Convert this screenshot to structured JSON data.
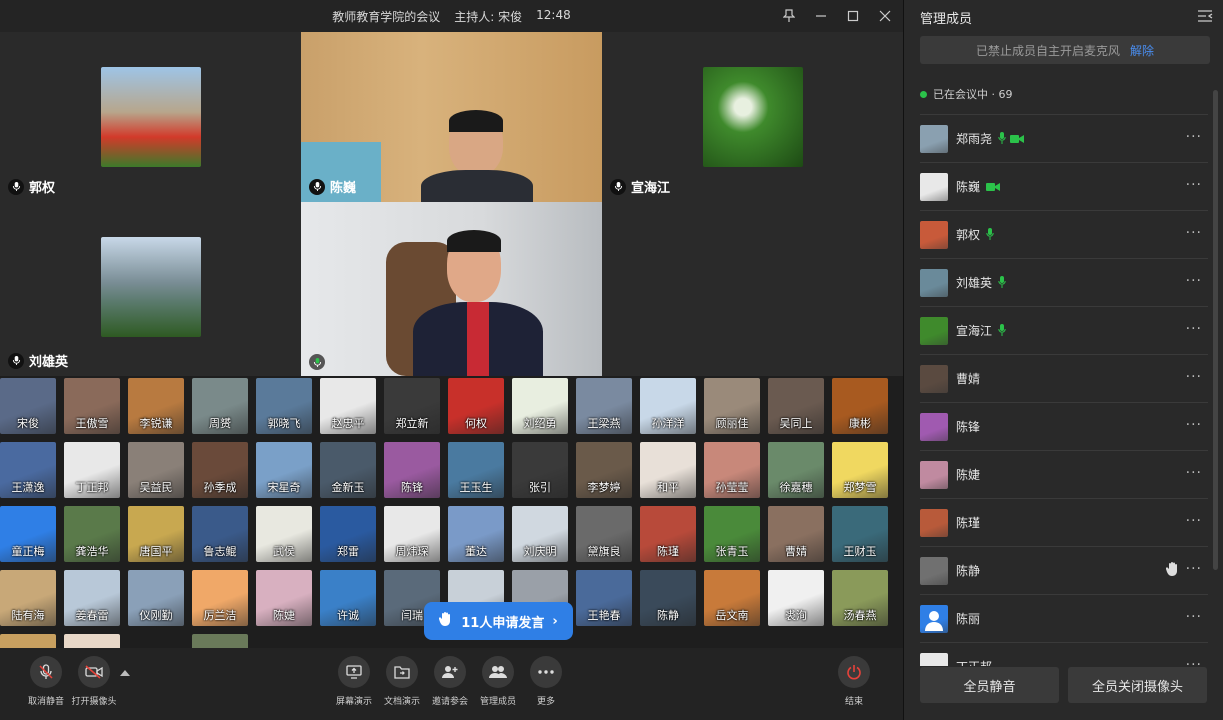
{
  "title": {
    "meeting": "教师教育学院的会议",
    "host": "主持人: 宋俊",
    "time": "12:48"
  },
  "stage": [
    {
      "name": "郭权",
      "has_name": true
    },
    {
      "name": "陈巍",
      "has_name": true
    },
    {
      "name": "宣海江",
      "has_name": true
    },
    {
      "name": "刘雄英",
      "has_name": true
    },
    {
      "name": "",
      "has_name": false
    }
  ],
  "grid": {
    "names": [
      "宋俊",
      "王傲雪",
      "李锐谦",
      "周赟",
      "郭晓飞",
      "赵忠平",
      "郑立新",
      "何权",
      "刘绍勇",
      "王梁燕",
      "孙洋洋",
      "顾丽佳",
      "吴同上",
      "康彬",
      "王潇逸",
      "丁正邦",
      "吴益民",
      "孙季成",
      "宋星奇",
      "金新玉",
      "陈锋",
      "王玉生",
      "张引",
      "李梦婷",
      "和平",
      "孙莹莹",
      "徐嘉穗",
      "郑梦雪",
      "童正梅",
      "龚浩华",
      "唐国平",
      "鲁志鲲",
      "武侯",
      "郑雷",
      "周炜琛",
      "董达",
      "刘庆明",
      "黛旗良",
      "陈瑾",
      "张青玉",
      "曹婧",
      "王财玉",
      "陆有海",
      "姜春雷",
      "仪刚勤",
      "厉兰洁",
      "陈婕",
      "许诚",
      "闫瑞",
      "",
      "",
      "王艳春",
      "陈静",
      "岳文南",
      "裘洵",
      "汤春燕"
    ],
    "raise_hand": "11人申请发言"
  },
  "toolbar": {
    "mute": "取消静音",
    "camera": "打开摄像头",
    "screen": "屏幕演示",
    "doc": "文档演示",
    "invite": "邀请参会",
    "members": "管理成员",
    "more": "更多",
    "end": "结束"
  },
  "panel": {
    "title": "管理成员",
    "notice": "已禁止成员自主开启麦克风",
    "notice_action": "解除",
    "in_meeting": "已在会议中 · 69",
    "members": [
      {
        "name": "郑雨尧",
        "mic": true,
        "cam": true,
        "hand": false
      },
      {
        "name": "陈巍",
        "mic": false,
        "cam": true,
        "hand": false
      },
      {
        "name": "郭权",
        "mic": true,
        "cam": false,
        "hand": false
      },
      {
        "name": "刘雄英",
        "mic": true,
        "cam": false,
        "hand": false
      },
      {
        "name": "宣海江",
        "mic": true,
        "cam": false,
        "hand": false
      },
      {
        "name": "曹婧",
        "mic": false,
        "cam": false,
        "hand": false
      },
      {
        "name": "陈锋",
        "mic": false,
        "cam": false,
        "hand": false
      },
      {
        "name": "陈婕",
        "mic": false,
        "cam": false,
        "hand": false
      },
      {
        "name": "陈瑾",
        "mic": false,
        "cam": false,
        "hand": false
      },
      {
        "name": "陈静",
        "mic": false,
        "cam": false,
        "hand": true
      },
      {
        "name": "陈丽",
        "mic": false,
        "cam": false,
        "hand": false
      },
      {
        "name": "丁正邦",
        "mic": false,
        "cam": false,
        "hand": false
      }
    ],
    "mute_all": "全员静音",
    "cam_off_all": "全员关闭摄像头"
  },
  "colors": {
    "accent": "#2f7fe6",
    "active_green": "#2bc24a",
    "end_red": "#e8423a"
  }
}
